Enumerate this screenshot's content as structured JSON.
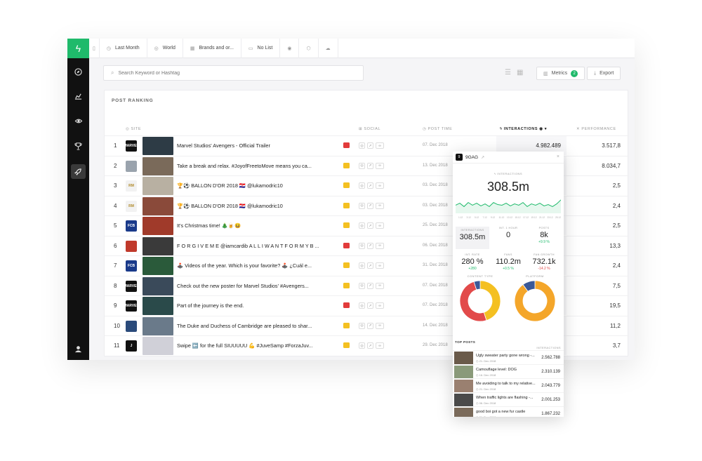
{
  "colors": {
    "accent": "#1fba6b",
    "sidebar": "#111111",
    "youtube": "#e23b3b",
    "image": "#f4c021",
    "red": "#e24a4a"
  },
  "sidebar": {
    "logo_icon": "lightning-icon",
    "items": [
      {
        "icon": "compass-icon"
      },
      {
        "icon": "chart-icon"
      },
      {
        "icon": "eye-icon"
      },
      {
        "icon": "trophy-icon"
      },
      {
        "icon": "rocket-icon",
        "active": true
      }
    ],
    "user_icon": "user-icon"
  },
  "topbar": {
    "items": [
      {
        "icon": "bookmark-icon",
        "label": ""
      },
      {
        "icon": "clock-icon",
        "label": "Last Month"
      },
      {
        "icon": "globe-icon",
        "label": "World"
      },
      {
        "icon": "building-icon",
        "label": "Brands and or..."
      },
      {
        "icon": "folder-icon",
        "label": "No List"
      },
      {
        "icon": "target-icon",
        "label": ""
      },
      {
        "icon": "cube-icon",
        "label": ""
      },
      {
        "icon": "cloud-icon",
        "label": ""
      }
    ]
  },
  "search": {
    "placeholder": "Search Keyword or Hashtag"
  },
  "toolbar": {
    "metrics_label": "Metrics",
    "metrics_count": "2",
    "export_label": "Export"
  },
  "ranking": {
    "title": "POST RANKING",
    "columns": {
      "site": "SITE",
      "social": "SOCIAL",
      "post_time": "POST TIME",
      "interactions": "INTERACTIONS",
      "performance": "PERFORMANCE"
    },
    "rows": [
      {
        "rank": "1",
        "title": "Marvel Studios' Avengers - Official Trailer",
        "type": "video",
        "time": "07. Dec 2018",
        "interactions": "4.982.489",
        "performance": "3.517,8",
        "avatar": "MARVEL",
        "avatar_color": "#111",
        "thumb_color": "#2d3b45"
      },
      {
        "rank": "2",
        "title": "Take a break and relax. #JoyofFreetoMove means you ca...",
        "type": "image",
        "time": "13. Dec 2018",
        "interactions": "",
        "performance": "8.034,7",
        "avatar": "",
        "avatar_color": "#9aa3ad",
        "thumb_color": "#7a6a5a"
      },
      {
        "rank": "3",
        "title": "🏆⚽ BALLON D'OR 2018 🇭🇷 @lukamodric10",
        "type": "image",
        "time": "03. Dec 2018",
        "interactions": "",
        "performance": "2,5",
        "avatar": "RM",
        "avatar_color": "#f2f2f2",
        "thumb_color": "#b8b0a2"
      },
      {
        "rank": "4",
        "title": "🏆⚽ BALLON D'OR 2018 🇭🇷 @lukamodric10",
        "type": "image",
        "time": "03. Dec 2018",
        "interactions": "",
        "performance": "2,4",
        "avatar": "RM",
        "avatar_color": "#f2f2f2",
        "thumb_color": "#8a4a3a"
      },
      {
        "rank": "5",
        "title": "It's Christmas time! 🎄🍺😆",
        "type": "image",
        "time": "25. Dec 2018",
        "interactions": "",
        "performance": "2,5",
        "avatar": "FCB",
        "avatar_color": "#1a3a8a",
        "thumb_color": "#a03a2a"
      },
      {
        "rank": "6",
        "title": "F O R G I V E M E @iamcardib A L L I W A N T F O R M Y B ...",
        "type": "video",
        "time": "06. Dec 2018",
        "interactions": "",
        "performance": "13,3",
        "avatar": "",
        "avatar_color": "#c0392b",
        "thumb_color": "#3a3a3a"
      },
      {
        "rank": "7",
        "title": "🕹️ Videos of the year. Which is your favorite? 🕹️ ¿Cuál e...",
        "type": "image",
        "time": "31. Dec 2018",
        "interactions": "",
        "performance": "2,4",
        "avatar": "FCB",
        "avatar_color": "#1a3a8a",
        "thumb_color": "#2a5a3a"
      },
      {
        "rank": "8",
        "title": "Check out the new poster for Marvel Studios' #Avengers...",
        "type": "image",
        "time": "07. Dec 2018",
        "interactions": "",
        "performance": "7,5",
        "avatar": "MARVEL",
        "avatar_color": "#111",
        "thumb_color": "#3a4a5a"
      },
      {
        "rank": "9",
        "title": "Part of the journey is the end.",
        "type": "video",
        "time": "07. Dec 2018",
        "interactions": "",
        "performance": "19,5",
        "avatar": "MARVEL",
        "avatar_color": "#111",
        "thumb_color": "#2a4a4a"
      },
      {
        "rank": "10",
        "title": "The Duke and Duchess of Cambridge are pleased to shar...",
        "type": "image",
        "time": "14. Dec 2018",
        "interactions": "",
        "performance": "11,2",
        "avatar": "",
        "avatar_color": "#2a4a7a",
        "thumb_color": "#6a7a8a"
      },
      {
        "rank": "11",
        "title": "Swipe ⬅️ for the full SIUUUUU 💪 #JuveSamp #ForzaJuv...",
        "type": "image",
        "time": "29. Dec 2018",
        "interactions": "",
        "performance": "3,7",
        "avatar": "J",
        "avatar_color": "#111",
        "thumb_color": "#d0d0d8"
      }
    ]
  },
  "popup": {
    "name": "9GAG",
    "logo": "9",
    "interactions_label": "INTERACTIONS",
    "interactions_value": "308.5m",
    "chart_x_labels": [
      "1.12",
      "3.12",
      "5.12",
      "7.12",
      "9.12",
      "11.12",
      "13.12",
      "15.12",
      "17.12",
      "19.12",
      "21.12",
      "23.12",
      "25.12"
    ],
    "chart_series": [
      52,
      55,
      50,
      56,
      52,
      55,
      51,
      54,
      50,
      56,
      53,
      52,
      55,
      51,
      54,
      52,
      56,
      50,
      54,
      52,
      55,
      51,
      53,
      50,
      54,
      60
    ],
    "stats": [
      {
        "label": "INTERACTIONS",
        "value": "308.5m",
        "delta": "",
        "delta_class": ""
      },
      {
        "label": "INT. 1 HOUR",
        "value": "0",
        "delta": "",
        "delta_class": ""
      },
      {
        "label": "POSTS",
        "value": "8k",
        "delta": "+9.9 %",
        "delta_class": "green"
      },
      {
        "label": "INT. RATE",
        "value": "280 %",
        "delta": "+280",
        "delta_class": "green"
      },
      {
        "label": "FANS",
        "value": "110.2m",
        "delta": "+0.5 %",
        "delta_class": "green"
      },
      {
        "label": "FAN GROWTH",
        "value": "732.1k",
        "delta": "-14.2 %",
        "delta_class": "red"
      }
    ],
    "content_type_label": "CONTENT TYPE",
    "platform_label": "PLATFORM",
    "content_type_slices": [
      {
        "name": "image",
        "value": 45,
        "color": "#f4c021"
      },
      {
        "name": "video",
        "value": 50,
        "color": "#e24a4a"
      },
      {
        "name": "other",
        "value": 5,
        "color": "#3b5998"
      }
    ],
    "platform_slices": [
      {
        "name": "instagram",
        "value": 90,
        "color": "#f4a62a"
      },
      {
        "name": "facebook",
        "value": 10,
        "color": "#3b5998"
      }
    ],
    "top_posts_label": "TOP POSTS",
    "top_posts_sub": "INTERACTIONS",
    "top_posts": [
      {
        "title": "Ugly sweater party gone wrong -...",
        "date": "21. Dec 2018",
        "value": "2.562.788",
        "thumb": "#6a5a4a"
      },
      {
        "title": "Camouflage level: DOG",
        "date": "16. Dec 2018",
        "value": "2.310.139",
        "thumb": "#8a9a7a"
      },
      {
        "title": "Me avoiding to talk to my relative...",
        "date": "21. Dec 2018",
        "value": "2.043.779",
        "thumb": "#9a8070"
      },
      {
        "title": "When traffic lights are flashing -...",
        "date": "06. Dec 2018",
        "value": "2.001.253",
        "thumb": "#4a4a4a"
      },
      {
        "title": "good boi got a new fur castle",
        "date": "21. Dec 2018",
        "value": "1.867.232",
        "thumb": "#7a6a5a"
      }
    ]
  }
}
